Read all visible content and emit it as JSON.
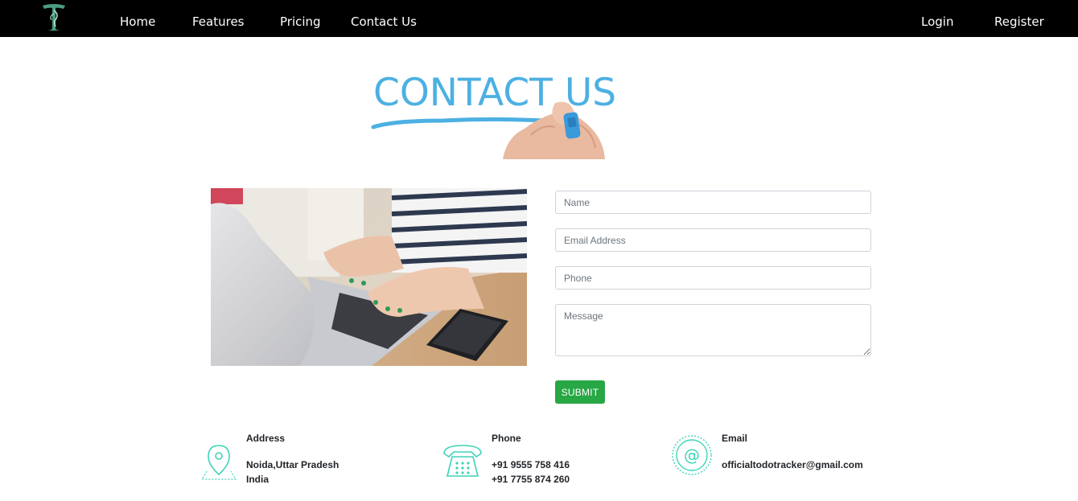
{
  "nav": {
    "logo_letter": "T",
    "links": [
      "Home",
      "Features",
      "Pricing",
      "Contact Us"
    ],
    "login": "Login",
    "register": "Register"
  },
  "hero": {
    "title": "CONTACT US"
  },
  "form": {
    "name_placeholder": "Name",
    "email_placeholder": "Email Address",
    "phone_placeholder": "Phone",
    "message_placeholder": "Message",
    "submit_label": "SUBMIT"
  },
  "contact": {
    "address": {
      "title": "Address",
      "line1": "Noida,Uttar Pradesh",
      "line2": "India",
      "icon": "map-pin-icon"
    },
    "phone": {
      "title": "Phone",
      "line1": "+91 9555 758 416",
      "line2": "+91 7755 874 260",
      "icon": "telephone-icon"
    },
    "email": {
      "title": "Email",
      "line1": "officialtodotracker@gmail.com",
      "icon": "at-sign-icon"
    }
  },
  "colors": {
    "nav_bg": "#000000",
    "accent_blue": "#4cb0e2",
    "submit_green": "#28a745",
    "icon_teal": "#3ed3b8"
  }
}
